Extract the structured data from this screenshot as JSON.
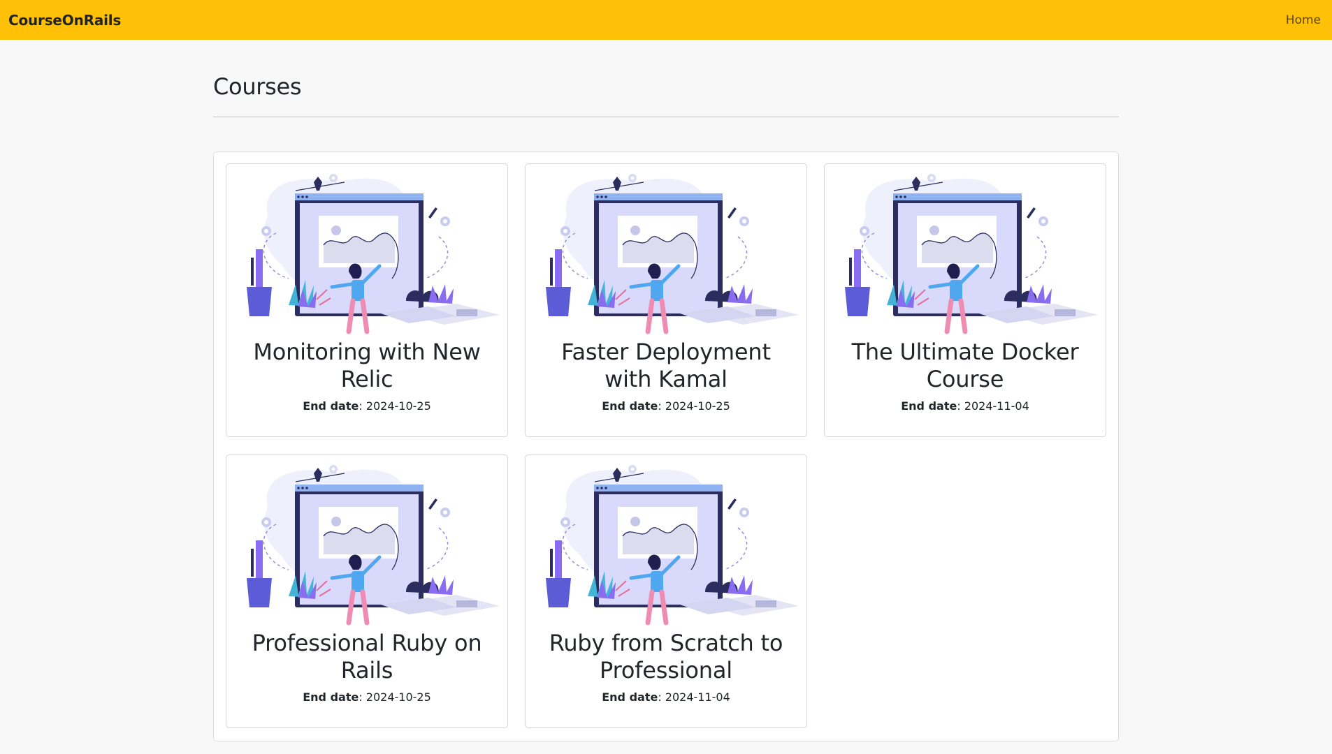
{
  "navbar": {
    "brand": "CourseOnRails",
    "home_link": "Home",
    "color": "#ffc107"
  },
  "page": {
    "title": "Courses"
  },
  "courses": [
    {
      "title": "Monitoring with New Relic",
      "end_date_label": "End date",
      "end_date": "2024-10-25",
      "image": "course-illustration"
    },
    {
      "title": "Faster Deployment with Kamal",
      "end_date_label": "End date",
      "end_date": "2024-10-25",
      "image": "course-illustration"
    },
    {
      "title": "The Ultimate Docker Course",
      "end_date_label": "End date",
      "end_date": "2024-11-04",
      "image": "course-illustration"
    },
    {
      "title": "Professional Ruby on Rails",
      "end_date_label": "End date",
      "end_date": "2024-10-25",
      "image": "course-illustration"
    },
    {
      "title": "Ruby from Scratch to Professional",
      "end_date_label": "End date",
      "end_date": "2024-11-04",
      "image": "course-illustration"
    }
  ]
}
